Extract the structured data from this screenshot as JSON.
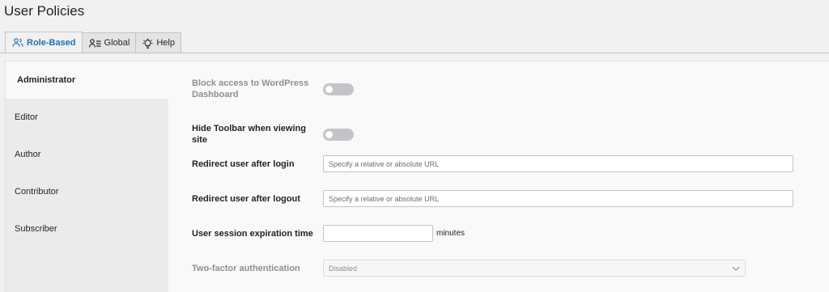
{
  "page": {
    "title": "User Policies"
  },
  "tabs": [
    {
      "label": "Role-Based",
      "icon": "users-icon",
      "active": true
    },
    {
      "label": "Global",
      "icon": "user-list-icon",
      "active": false
    },
    {
      "label": "Help",
      "icon": "lightbulb-icon",
      "active": false
    }
  ],
  "roles": [
    {
      "label": "Administrator",
      "active": true
    },
    {
      "label": "Editor",
      "active": false
    },
    {
      "label": "Author",
      "active": false
    },
    {
      "label": "Contributor",
      "active": false
    },
    {
      "label": "Subscriber",
      "active": false
    }
  ],
  "settings": {
    "block_dashboard": {
      "label": "Block access to WordPress Dashboard",
      "enabled": false,
      "disabled": true
    },
    "hide_toolbar": {
      "label": "Hide Toolbar when viewing site",
      "enabled": false
    },
    "redirect_login": {
      "label": "Redirect user after login",
      "value": "",
      "placeholder": "Specify a relative or absolute URL"
    },
    "redirect_logout": {
      "label": "Redirect user after logout",
      "value": "",
      "placeholder": "Specify a relative or absolute URL"
    },
    "session_expiration": {
      "label": "User session expiration time",
      "value": "",
      "suffix": "minutes"
    },
    "two_factor": {
      "label": "Two-factor authentication",
      "selected": "Disabled",
      "disabled": true
    }
  },
  "colors": {
    "accent": "#2271b1",
    "toggle_off": "#c3c4c7",
    "panel_bg": "#f9f9f9",
    "sidebar_bg": "#ebebeb"
  }
}
